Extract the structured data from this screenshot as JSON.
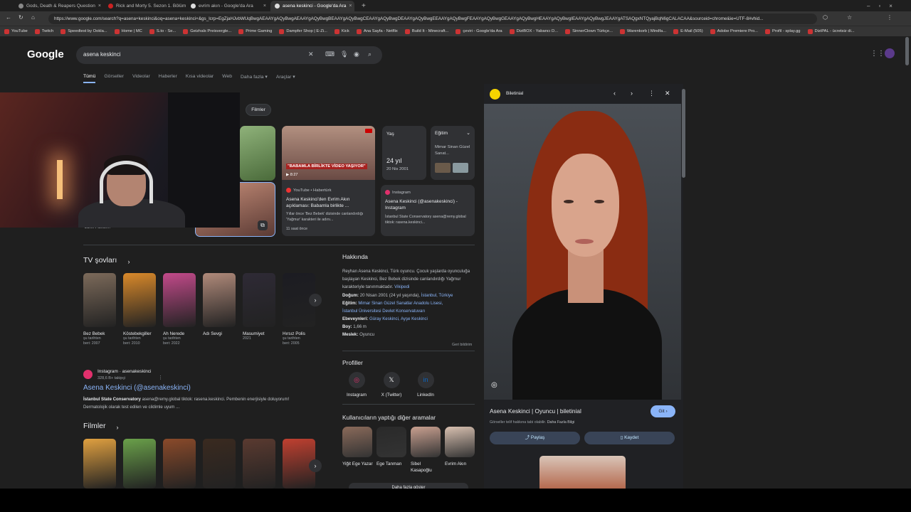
{
  "tabs": [
    {
      "title": "Gods, Death & Reapers Question"
    },
    {
      "title": "Rick and Morty 5. Sezon 1. Bölüm"
    },
    {
      "title": "evrim akın - Google'da Ara"
    },
    {
      "title": "asena keskinci - Google'da Ara"
    }
  ],
  "address": {
    "url": "https://www.google.com/search?q=asena+keskinci&oq=asena+keskinci+&gs_lcrp=EgZjaHJvbWUqBwgAEAAYgAQyBwgAEAAYgAQyBwgBEAAYgAQyBwgCEAAYgAQyBwgDEAAYgAQyBwgEEAAYgAQyBwgFEAAYgAQyBwgGEAAYgAQyBwgHEAAYgAQyBwgIEAAYgAQyBwgJEAAYgATSAQgxNTQyajBqN6gCALACAA&sourceid=chrome&ie=UTF-8#vhid..."
  },
  "bookmarks": [
    "YouTube",
    "Twitch",
    "Speedtest by Ookla...",
    "Home | MC",
    "S.to - Se...",
    "Geizhals Preisvergle...",
    "Prime Gaming",
    "Dampfer Shop | E-Zi...",
    "Kick",
    "Ana Sayfa - Netflix",
    "Build It - Minecraft...",
    "çeviri - Google'da Ara",
    "DiziBOX - Yabancı D...",
    "SinnerClown Türkçe...",
    "Warenkorb | Mindfa...",
    "E-Mail (505)",
    "Adobe Premiere Pro...",
    "Profil - splay.gg",
    "DiziPAL - ücretsiz di..."
  ],
  "google": {
    "logo": "Google",
    "query": "asena keskinci",
    "nav": [
      "Tümü",
      "Görseller",
      "Videolar",
      "Haberler",
      "Kısa videolar",
      "Web",
      "Daha fazla ▾",
      "Araçlar ▾"
    ]
  },
  "chip": "Filmler",
  "cards": {
    "video": {
      "source": "YouTube • Habertürk",
      "title": "Asena Keskinci'den Evrim Akın açıklaması: Babamla birlikte ...",
      "desc": "Yıllar önce 'Bez Bebek' dizisinde canlandırdığı 'Yağmur' karakteri ile adını...",
      "time": "11 saat önce",
      "overlay": "\"BABAMLA BİRLİKTE VİDEO YAŞIYOR\"",
      "duration": "▶ 8:27"
    },
    "age": {
      "label": "Yaş",
      "value": "24 yıl",
      "date": "20 Nis 2001"
    },
    "edu": {
      "label": "Eğitim",
      "value": "Mimar Sinan Güzel Sanat..."
    },
    "insta": {
      "source": "Instagram",
      "title": "Asena Keskinci (@asenakeskinci) - Instagram",
      "desc": "İstanbul State Conservatory asena@remy.global tiktok: rasena.keskinci..."
    },
    "partial_label": "John Fisher..."
  },
  "tv": {
    "title": "TV şovları",
    "items": [
      {
        "name": "Bez Bebek",
        "meta1": "şu tarihten",
        "meta2": "beri: 2007",
        "color": "#7c6a5a"
      },
      {
        "name": "Köstebekgiller",
        "meta1": "şu tarihten",
        "meta2": "beri: 2010",
        "color": "#d9892a"
      },
      {
        "name": "Ah Nerede",
        "meta1": "şu tarihten",
        "meta2": "beri: 2022",
        "color": "#c24a8a"
      },
      {
        "name": "Adı Sevgi",
        "meta1": "",
        "meta2": "",
        "color": "#b08a7a"
      },
      {
        "name": "Masumiyet",
        "meta1": "2021",
        "meta2": "",
        "color": "#2e2a35"
      },
      {
        "name": "Hırsız Polis",
        "meta1": "şu tarihten",
        "meta2": "beri: 2005",
        "color": "#1c1c22"
      }
    ]
  },
  "insta_result": {
    "site": "Instagram · asenakeskinci",
    "followers": "328,6 B+ takipçi",
    "title": "Asena Keskinci (@asenakeskinci)",
    "snippet_bold": "İstanbul State Conservatory",
    "snippet": " asena@remy.global tiktok: rasena.keskinci. Pembenin enerjisiyle doluyorum! Dermatolojik olarak test edilen ve cildimle uyum ..."
  },
  "films": {
    "title": "Filmler",
    "items": [
      {
        "color": "#e0a040"
      },
      {
        "color": "#6aa04a"
      },
      {
        "color": "#8a4a2a"
      },
      {
        "color": "#3a2a20"
      },
      {
        "color": "#5a3a30"
      },
      {
        "color": "#c04030"
      }
    ]
  },
  "about": {
    "title": "Hakkında",
    "desc": "Reyhan Asena Keskinci, Türk oyuncu. Çocuk yaşlarda oyunculuğa başlayan Keskinci, Bez Bebek dizisinde canlandırdığı Yağmur karakteriyle tanınmaktadır.",
    "wiki": "Vikipedi",
    "facts": [
      {
        "k": "Doğum:",
        "v": "20 Nisan 2001 (24 yıl yaşında),",
        "l": "İstanbul, Türkiye"
      },
      {
        "k": "Eğitim:",
        "v": "",
        "l": "Mimar Sinan Güzel Sanatlar Anadolu Lisesi,"
      },
      {
        "k": "",
        "v": "",
        "l": "İstanbul Üniversitesi Devlet Konservatuvarı"
      },
      {
        "k": "Ebeveynleri:",
        "v": "",
        "l": "Güray Keskinci, Ayşe Keskinci"
      },
      {
        "k": "Boy:",
        "v": "1,66 m",
        "l": ""
      },
      {
        "k": "Meslek:",
        "v": "Oyuncu",
        "l": ""
      }
    ],
    "feedback": "Geri bildirim"
  },
  "profiles": {
    "title": "Profiller",
    "items": [
      {
        "name": "Instagram",
        "glyph": "◎",
        "color": "#e1306c"
      },
      {
        "name": "X (Twitter)",
        "glyph": "𝕏",
        "color": "#fff"
      },
      {
        "name": "LinkedIn",
        "glyph": "in",
        "color": "#0a66c2"
      }
    ]
  },
  "people": {
    "title": "Kullanıcıların yaptığı diğer aramalar",
    "items": [
      {
        "name": "Yiğit Ege Yazar",
        "color": "#8a6a5a"
      },
      {
        "name": "Ege Tanman",
        "color": "#2a2a2a"
      },
      {
        "name": "Sibel Kasapoğlu",
        "color": "#c9a090"
      },
      {
        "name": "Evrim Akın",
        "color": "#d8c0b0"
      }
    ],
    "more": "Daha fazla göster"
  },
  "panel": {
    "site": "Biletinial",
    "caption": "Asena Keskinci | Oyuncu | biletinial",
    "go": "Git ›",
    "note_text": "Görseller telif hakkına tabi olabilir.",
    "note_link": "Daha Fazla Bilgi",
    "share": "Paylaş",
    "save": "Kaydet"
  }
}
